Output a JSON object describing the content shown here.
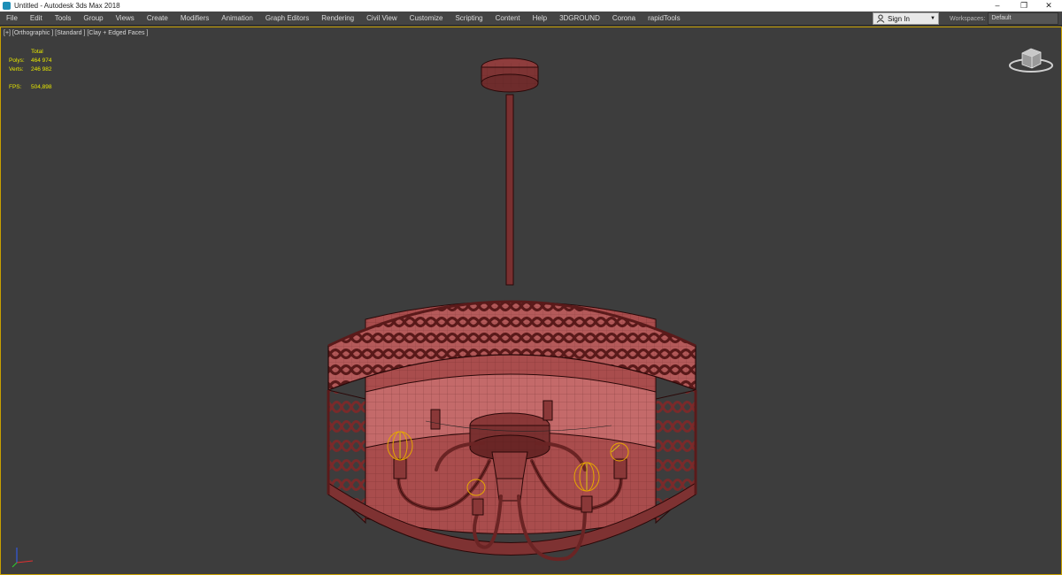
{
  "window": {
    "title": "Untitled - Autodesk 3ds Max 2018"
  },
  "window_controls": {
    "minimize": "–",
    "maximize": "❐",
    "close": "✕"
  },
  "menu": [
    "File",
    "Edit",
    "Tools",
    "Group",
    "Views",
    "Create",
    "Modifiers",
    "Animation",
    "Graph Editors",
    "Rendering",
    "Civil View",
    "Customize",
    "Scripting",
    "Content",
    "Help",
    "3DGROUND",
    "Corona",
    "rapidTools"
  ],
  "signin": {
    "label": "Sign In",
    "icon": "user-icon"
  },
  "workspaces": {
    "label": "Workspaces:",
    "value": "Default"
  },
  "viewport": {
    "label": "[+] [Orthographic ] [Standard ] [Clay + Edged Faces ]",
    "stats": {
      "header": "Total",
      "polys_label": "Polys:",
      "polys": "464 974",
      "verts_label": "Verts:",
      "verts": "246 982",
      "fps_label": "FPS:",
      "fps": "504,898"
    }
  },
  "colors": {
    "accent": "#c8a000",
    "model": "#8a3a3a",
    "wire": "#2a0808",
    "stats": "#e8e800"
  }
}
